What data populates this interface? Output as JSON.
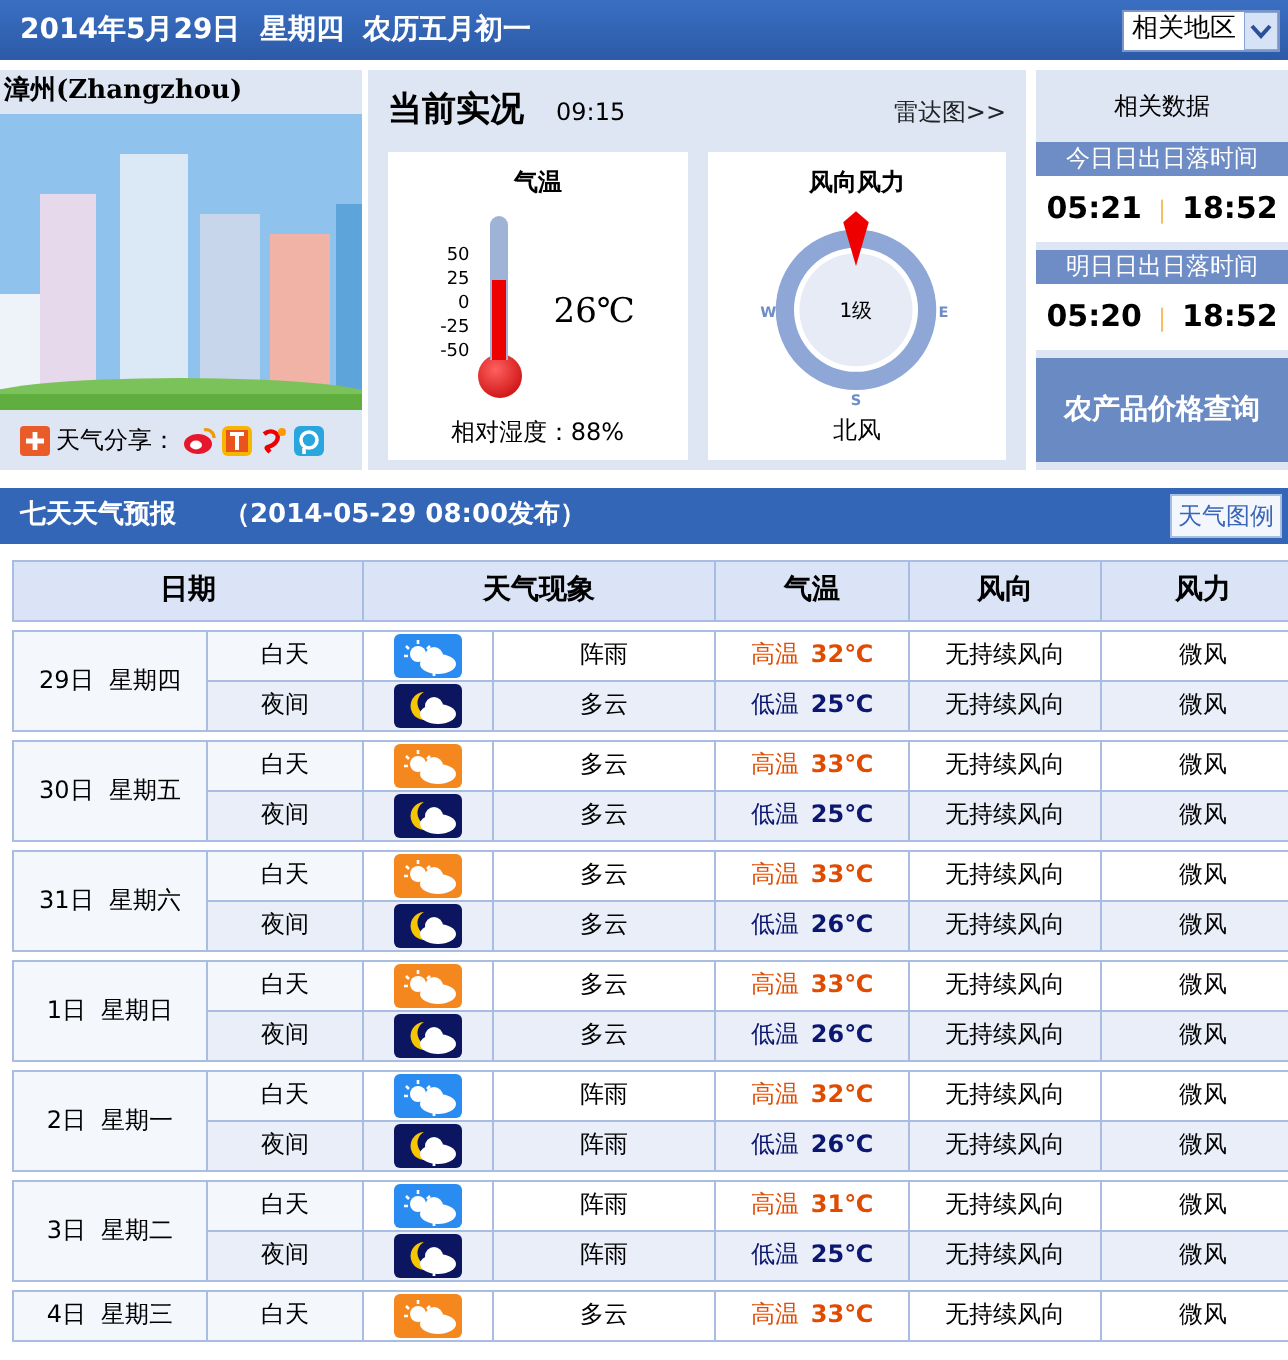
{
  "header": {
    "date_text": "2014年5月29日  星期四  农历五月初一",
    "region_select": "相关地区"
  },
  "city": {
    "name": "漳州(Zhangzhou)",
    "share_label": "天气分享："
  },
  "current": {
    "title": "当前实况",
    "time": "09:15",
    "radar_link": "雷达图>>",
    "temperature": {
      "title": "气温",
      "ticks": [
        "50",
        "25",
        "0",
        "-25",
        "-50"
      ],
      "level": 0.55,
      "reading": "26℃",
      "humidity": "相对湿度：88%"
    },
    "wind": {
      "title": "风向风力",
      "compass_labels": [
        {
          "kind": "west",
          "label": "W"
        },
        {
          "kind": "east",
          "label": "E"
        },
        {
          "kind": "south",
          "label": "S"
        }
      ],
      "force": "1级",
      "direction": "北风"
    }
  },
  "related": {
    "title": "相关数据",
    "sun_times": [
      {
        "title": "今日日出日落时间",
        "sunrise": "05:21",
        "separator": "|",
        "sunset": "18:52"
      },
      {
        "title": "明日日出日落时间",
        "sunrise": "05:20",
        "separator": "|",
        "sunset": "18:52"
      }
    ],
    "price_button": "农产品价格查询"
  },
  "forecast": {
    "title": "七天天气预报",
    "published": "（2014-05-29 08:00发布）",
    "legend_button": "天气图例",
    "columns": [
      "日期",
      "天气现象",
      "气温",
      "风向",
      "风力"
    ],
    "days": [
      {
        "date": "29日  星期四",
        "periods": [
          {
            "kind": "shower_day",
            "label": "白天",
            "weather": "阵雨",
            "temp_label": "高温",
            "temp": "32℃",
            "wind_direction": "无持续风向",
            "wind_force": "微风"
          },
          {
            "kind": "cloudy_night",
            "label": "夜间",
            "weather": "多云",
            "temp_label": "低温",
            "temp": "25℃",
            "wind_direction": "无持续风向",
            "wind_force": "微风"
          }
        ]
      },
      {
        "date": "30日  星期五",
        "periods": [
          {
            "kind": "cloudy_day",
            "label": "白天",
            "weather": "多云",
            "temp_label": "高温",
            "temp": "33℃",
            "wind_direction": "无持续风向",
            "wind_force": "微风"
          },
          {
            "kind": "cloudy_night",
            "label": "夜间",
            "weather": "多云",
            "temp_label": "低温",
            "temp": "25℃",
            "wind_direction": "无持续风向",
            "wind_force": "微风"
          }
        ]
      },
      {
        "date": "31日  星期六",
        "periods": [
          {
            "kind": "cloudy_day",
            "label": "白天",
            "weather": "多云",
            "temp_label": "高温",
            "temp": "33℃",
            "wind_direction": "无持续风向",
            "wind_force": "微风"
          },
          {
            "kind": "cloudy_night",
            "label": "夜间",
            "weather": "多云",
            "temp_label": "低温",
            "temp": "26℃",
            "wind_direction": "无持续风向",
            "wind_force": "微风"
          }
        ]
      },
      {
        "date": "1日  星期日",
        "periods": [
          {
            "kind": "cloudy_day",
            "label": "白天",
            "weather": "多云",
            "temp_label": "高温",
            "temp": "33℃",
            "wind_direction": "无持续风向",
            "wind_force": "微风"
          },
          {
            "kind": "cloudy_night",
            "label": "夜间",
            "weather": "多云",
            "temp_label": "低温",
            "temp": "26℃",
            "wind_direction": "无持续风向",
            "wind_force": "微风"
          }
        ]
      },
      {
        "date": "2日  星期一",
        "periods": [
          {
            "kind": "shower_day",
            "label": "白天",
            "weather": "阵雨",
            "temp_label": "高温",
            "temp": "32℃",
            "wind_direction": "无持续风向",
            "wind_force": "微风"
          },
          {
            "kind": "shower_night",
            "label": "夜间",
            "weather": "阵雨",
            "temp_label": "低温",
            "temp": "26℃",
            "wind_direction": "无持续风向",
            "wind_force": "微风"
          }
        ]
      },
      {
        "date": "3日  星期二",
        "periods": [
          {
            "kind": "shower_day",
            "label": "白天",
            "weather": "阵雨",
            "temp_label": "高温",
            "temp": "31℃",
            "wind_direction": "无持续风向",
            "wind_force": "微风"
          },
          {
            "kind": "shower_night",
            "label": "夜间",
            "weather": "阵雨",
            "temp_label": "低温",
            "temp": "25℃",
            "wind_direction": "无持续风向",
            "wind_force": "微风"
          }
        ]
      },
      {
        "date": "4日  星期三",
        "periods": [
          {
            "kind": "cloudy_day",
            "label": "白天",
            "weather": "多云",
            "temp_label": "高温",
            "temp": "33℃",
            "wind_direction": "无持续风向",
            "wind_force": "微风"
          }
        ]
      }
    ]
  }
}
